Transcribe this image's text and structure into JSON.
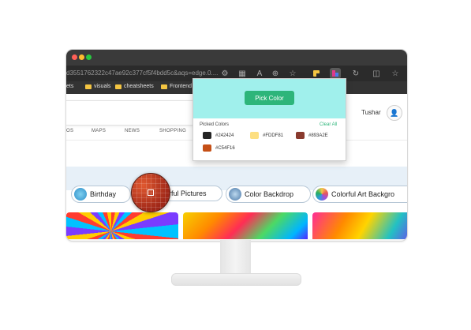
{
  "browser": {
    "url": "d3551762322c47ae92c377cf5f4bdd5c&aqs=edge.0....",
    "bookmarks": [
      {
        "label": "ets"
      },
      {
        "label": "visuals"
      },
      {
        "label": "cheatsheets"
      },
      {
        "label": "Frontend"
      }
    ],
    "toolbar_icons": [
      "settings-icon",
      "grid-icon",
      "read-aloud-icon",
      "zoom-icon",
      "star-icon",
      "color-picker-extension-icon",
      "extension-icon",
      "profile-sync-icon",
      "split-screen-icon",
      "favorites-icon"
    ]
  },
  "page": {
    "user_name": "Tushar",
    "nav_tabs": [
      "OS",
      "MAPS",
      "NEWS",
      "SHOPPING"
    ],
    "chips": [
      {
        "label": "Birthday"
      },
      {
        "label": "orful Pictures"
      },
      {
        "label": "Color Backdrop"
      },
      {
        "label": "Colorful Art Backgro"
      }
    ]
  },
  "popup": {
    "pick_button": "Pick Color",
    "picked_title": "Picked Colors",
    "clear_all": "Clear All",
    "colors": [
      {
        "label": "#242424",
        "hex": "#242424"
      },
      {
        "label": "#FDDF81",
        "hex": "#FDDF81"
      },
      {
        "label": "#893A2E",
        "hex": "#893A2E"
      },
      {
        "label": "#C54F16",
        "hex": "#C54F16"
      }
    ]
  },
  "colors": {
    "popup_header": "#a0f0ec",
    "pick_button": "#2db57a",
    "titlebar": "#3a3a3a",
    "toolbar": "#2b2b2b"
  }
}
